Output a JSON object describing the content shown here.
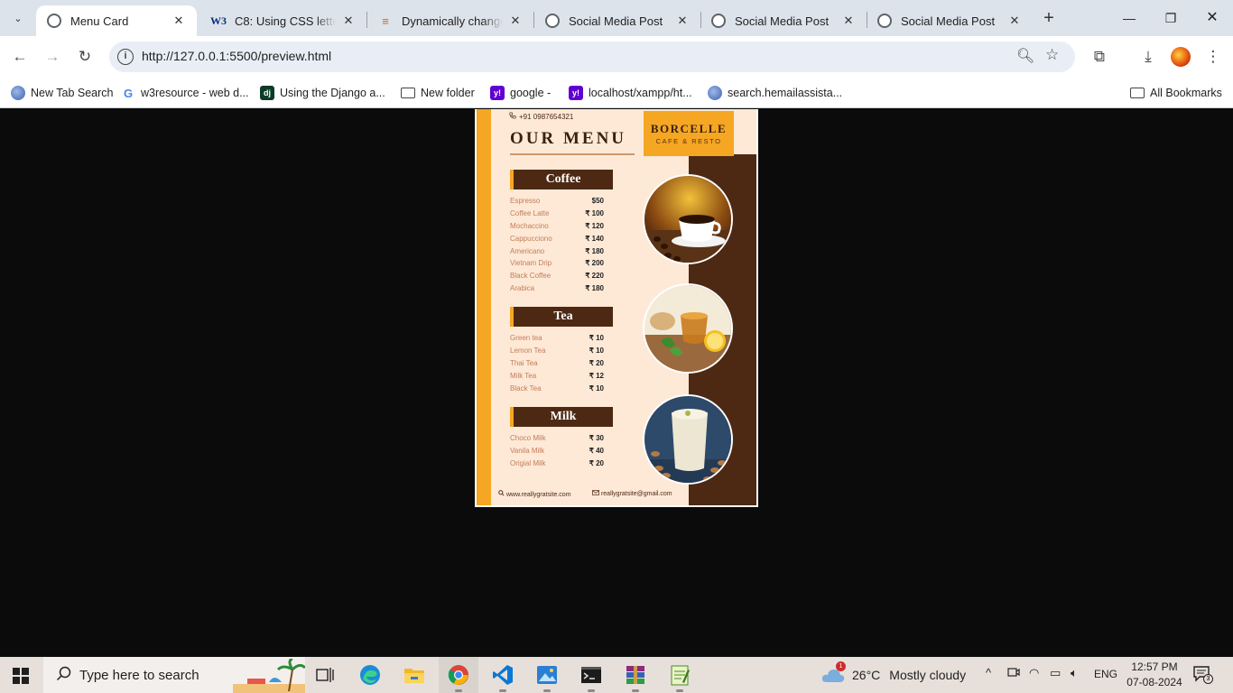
{
  "browser": {
    "tabs": [
      {
        "title": "Menu Card",
        "icon": "globe-icon",
        "active": true
      },
      {
        "title": "C8: Using CSS letter-s",
        "icon": "w3schools-icon",
        "active": false
      },
      {
        "title": "Dynamically change c",
        "icon": "stackoverflow-icon",
        "active": false
      },
      {
        "title": "Social Media Post",
        "icon": "globe-icon",
        "active": false
      },
      {
        "title": "Social Media Post",
        "icon": "globe-icon",
        "active": false
      },
      {
        "title": "Social Media Post",
        "icon": "globe-icon",
        "active": false
      }
    ],
    "url": "http://127.0.0.1:5500/preview.html",
    "bookmarks": [
      {
        "label": "New Tab Search",
        "icon": "globe-icon"
      },
      {
        "label": "w3resource - web d...",
        "icon": "google-icon"
      },
      {
        "label": "Using the Django a...",
        "icon": "django-icon"
      },
      {
        "label": "New folder",
        "icon": "folder-icon"
      },
      {
        "label": "google -",
        "icon": "yahoo-icon"
      },
      {
        "label": "localhost/xampp/ht...",
        "icon": "yahoo-icon"
      },
      {
        "label": "search.hemailassista...",
        "icon": "globe-icon"
      }
    ],
    "all_bookmarks": "All Bookmarks",
    "glyphs": {
      "tab_search": "⌄",
      "close": "✕",
      "new_tab": "+",
      "minimize": "—",
      "restore": "❐",
      "close_window": "✕",
      "back": "←",
      "forward": "→",
      "reload": "↻",
      "info": "i",
      "zoom": "🔍︎",
      "star": "☆",
      "extensions": "⧉",
      "download": "⤓",
      "menu": "⋮"
    }
  },
  "menu": {
    "phone": "+91 0987654321",
    "title": "OUR MENU",
    "brand": "BORCELLE",
    "brand_sub": "CAFE & RESTO",
    "sections": [
      {
        "name": "Coffee",
        "items": [
          {
            "name": "Espresso",
            "price": "$50"
          },
          {
            "name": "Coffee Latte",
            "price": "₹ 100"
          },
          {
            "name": "Mochaccino",
            "price": "₹ 120"
          },
          {
            "name": "Cappucciono",
            "price": "₹ 140"
          },
          {
            "name": "Americano",
            "price": "₹ 180"
          },
          {
            "name": "Vietnam Drip",
            "price": "₹ 200"
          },
          {
            "name": "Black Coffee",
            "price": "₹ 220"
          },
          {
            "name": "Arabica",
            "price": "₹ 180"
          }
        ]
      },
      {
        "name": "Tea",
        "items": [
          {
            "name": "Green tea",
            "price": "₹ 10"
          },
          {
            "name": "Lemon Tea",
            "price": "₹ 10"
          },
          {
            "name": "Thai Tea",
            "price": "₹ 20"
          },
          {
            "name": "Milk Tea",
            "price": "₹ 12"
          },
          {
            "name": "Black Tea",
            "price": "₹ 10"
          }
        ]
      },
      {
        "name": "Milk",
        "items": [
          {
            "name": "Choco Milk",
            "price": "₹ 30"
          },
          {
            "name": "Vanila Milk",
            "price": "₹ 40"
          },
          {
            "name": "Origial Milk",
            "price": "₹ 20"
          }
        ]
      }
    ],
    "website": "www.reallygratsite.com",
    "email": "reallygratsite@gmail.com",
    "colors": {
      "brown": "#4d2914",
      "orange": "#f5a623",
      "cream": "#fde9d6"
    }
  },
  "taskbar": {
    "search_placeholder": "Type here to search",
    "apps": [
      "task-view-icon",
      "edge-icon",
      "file-explorer-icon",
      "chrome-icon",
      "vscode-icon",
      "photos-icon",
      "terminal-icon",
      "winrar-icon",
      "notepad-icon"
    ],
    "weather_badge": "1",
    "temperature": "26°C",
    "weather": "Mostly cloudy",
    "tray_glyphs": {
      "chevron": "^",
      "wifi": "◠",
      "battery": "▭",
      "volume": "🔈︎"
    },
    "language": "ENG",
    "time": "12:57 PM",
    "date": "07-08-2024",
    "notifications": "3"
  }
}
